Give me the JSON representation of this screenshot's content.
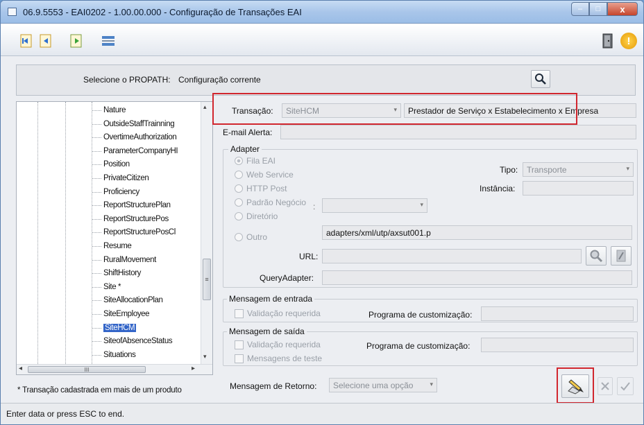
{
  "window": {
    "title": "06.9.5553 - EAI0202 - 1.00.00.000 - Configuração de Transações EAI",
    "minimize": "–",
    "maximize": "□",
    "close": "x"
  },
  "toolbar": {
    "icons": [
      "first-record-icon",
      "previous-record-icon",
      "next-record-icon",
      "list-icon"
    ],
    "right_icons": [
      "exit-door-icon",
      "help-icon"
    ],
    "help_label": "!"
  },
  "propath": {
    "label": "Selecione o PROPATH:",
    "value": "Configuração corrente",
    "search_icon": "search-icon"
  },
  "tree": {
    "items": [
      "Nature",
      "OutsideStaffTrainning",
      "OvertimeAuthorization",
      "ParameterCompanyHI",
      "Position",
      "PrivateCitizen",
      "Proficiency",
      "ReportStructurePlan",
      "ReportStructurePos",
      "ReportStructurePosCl",
      "Resume",
      "RuralMovement",
      "ShiftHistory",
      "Site *",
      "SiteAllocationPlan",
      "SiteEmployee",
      "SiteHCM",
      "SiteofAbsenceStatus",
      "Situations"
    ],
    "selected": "SiteHCM",
    "scroll_grip": "≡",
    "hscroll_grip": "III",
    "left_arrow": "◂",
    "right_arrow": "▸",
    "up_arrow": "▴",
    "down_arrow": "▾"
  },
  "footnote": "* Transação cadastrada em mais de um produto",
  "form": {
    "transacao_label": "Transação:",
    "transacao_value": "SiteHCM",
    "transacao_desc": "Prestador de Serviço x Estabelecimento x Empresa",
    "email_label": "E-mail Alerta:",
    "email_value": "",
    "adapter": {
      "title": "Adapter",
      "options": [
        "Fila EAI",
        "Web Service",
        "HTTP Post",
        "Padrão Negócio",
        "Diretório",
        "Outro"
      ],
      "padrao_sep": ":",
      "outro_value": "adapters/xml/utp/axsut001.p",
      "tipo_label": "Tipo:",
      "tipo_value": "Transporte",
      "instancia_label": "Instância:",
      "url_label": "URL:",
      "query_label": "QueryAdapter:"
    },
    "entrada": {
      "title": "Mensagem de entrada",
      "check": "Validação requerida",
      "prog_label": "Programa de customização:"
    },
    "saida": {
      "title": "Mensagem de saída",
      "check": "Validação requerida",
      "check2": "Mensagens de teste",
      "prog_label": "Programa de customização:"
    },
    "retorno": {
      "label": "Mensagem de Retorno:",
      "placeholder": "Selecione uma opção"
    },
    "arrow": "▾"
  },
  "status": {
    "text": "Enter data or press ESC to end."
  }
}
